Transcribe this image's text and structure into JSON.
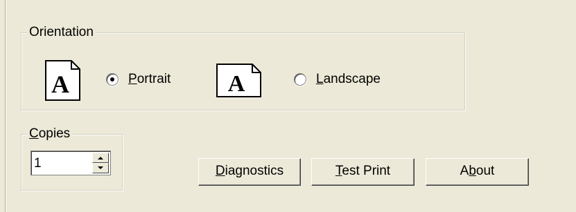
{
  "orientation": {
    "title": "Orientation",
    "portrait": {
      "label_ul": "P",
      "label_rest": "ortrait",
      "selected": true
    },
    "landscape": {
      "label_ul": "L",
      "label_rest": "andscape",
      "selected": false
    },
    "page_icon_glyph": "A"
  },
  "copies": {
    "title_ul": "C",
    "title_rest": "opies",
    "value": "1"
  },
  "buttons": {
    "diagnostics": {
      "ul": "D",
      "rest": "iagnostics"
    },
    "test_print": {
      "ul": "T",
      "rest": "est Print"
    },
    "about": {
      "pre": "A",
      "ul": "b",
      "rest": "out"
    }
  }
}
